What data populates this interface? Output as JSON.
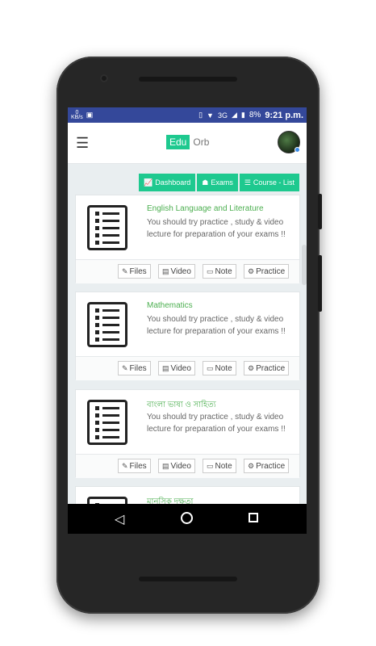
{
  "status_bar": {
    "net_speed": "0",
    "net_unit": "KB/s",
    "signal": "3G",
    "battery": "8%",
    "time": "9:21 p.m."
  },
  "app_bar": {
    "brand_edu": "Edu",
    "brand_orb": "Orb",
    "menu_icon": "hamburger-icon"
  },
  "actions": [
    {
      "label": "Dashboard",
      "icon": "chart-icon",
      "glyph": "📈"
    },
    {
      "label": "Exams",
      "icon": "exam-icon",
      "glyph": "☗"
    },
    {
      "label": "Course - List",
      "icon": "list-icon",
      "glyph": "☰"
    }
  ],
  "courses": [
    {
      "title": "English Language and Literature",
      "desc": "You should try practice , study & video lecture for preparation of your exams !!"
    },
    {
      "title": "Mathematics",
      "desc": "You should try practice , study & video lecture for preparation of your exams !!"
    },
    {
      "title": "বাংলা ভাষা ও সাহিত্য",
      "desc": "You should try practice , study & video lecture for preparation of your exams !!"
    },
    {
      "title": "মানসিক দক্ষতা",
      "desc": ""
    }
  ],
  "card_buttons": {
    "files": "Files",
    "video": "Video",
    "note": "Note",
    "practice": "Practice"
  },
  "colors": {
    "accent": "#1ec98f",
    "status_bar": "#34489a",
    "title_green": "#4caf50"
  }
}
